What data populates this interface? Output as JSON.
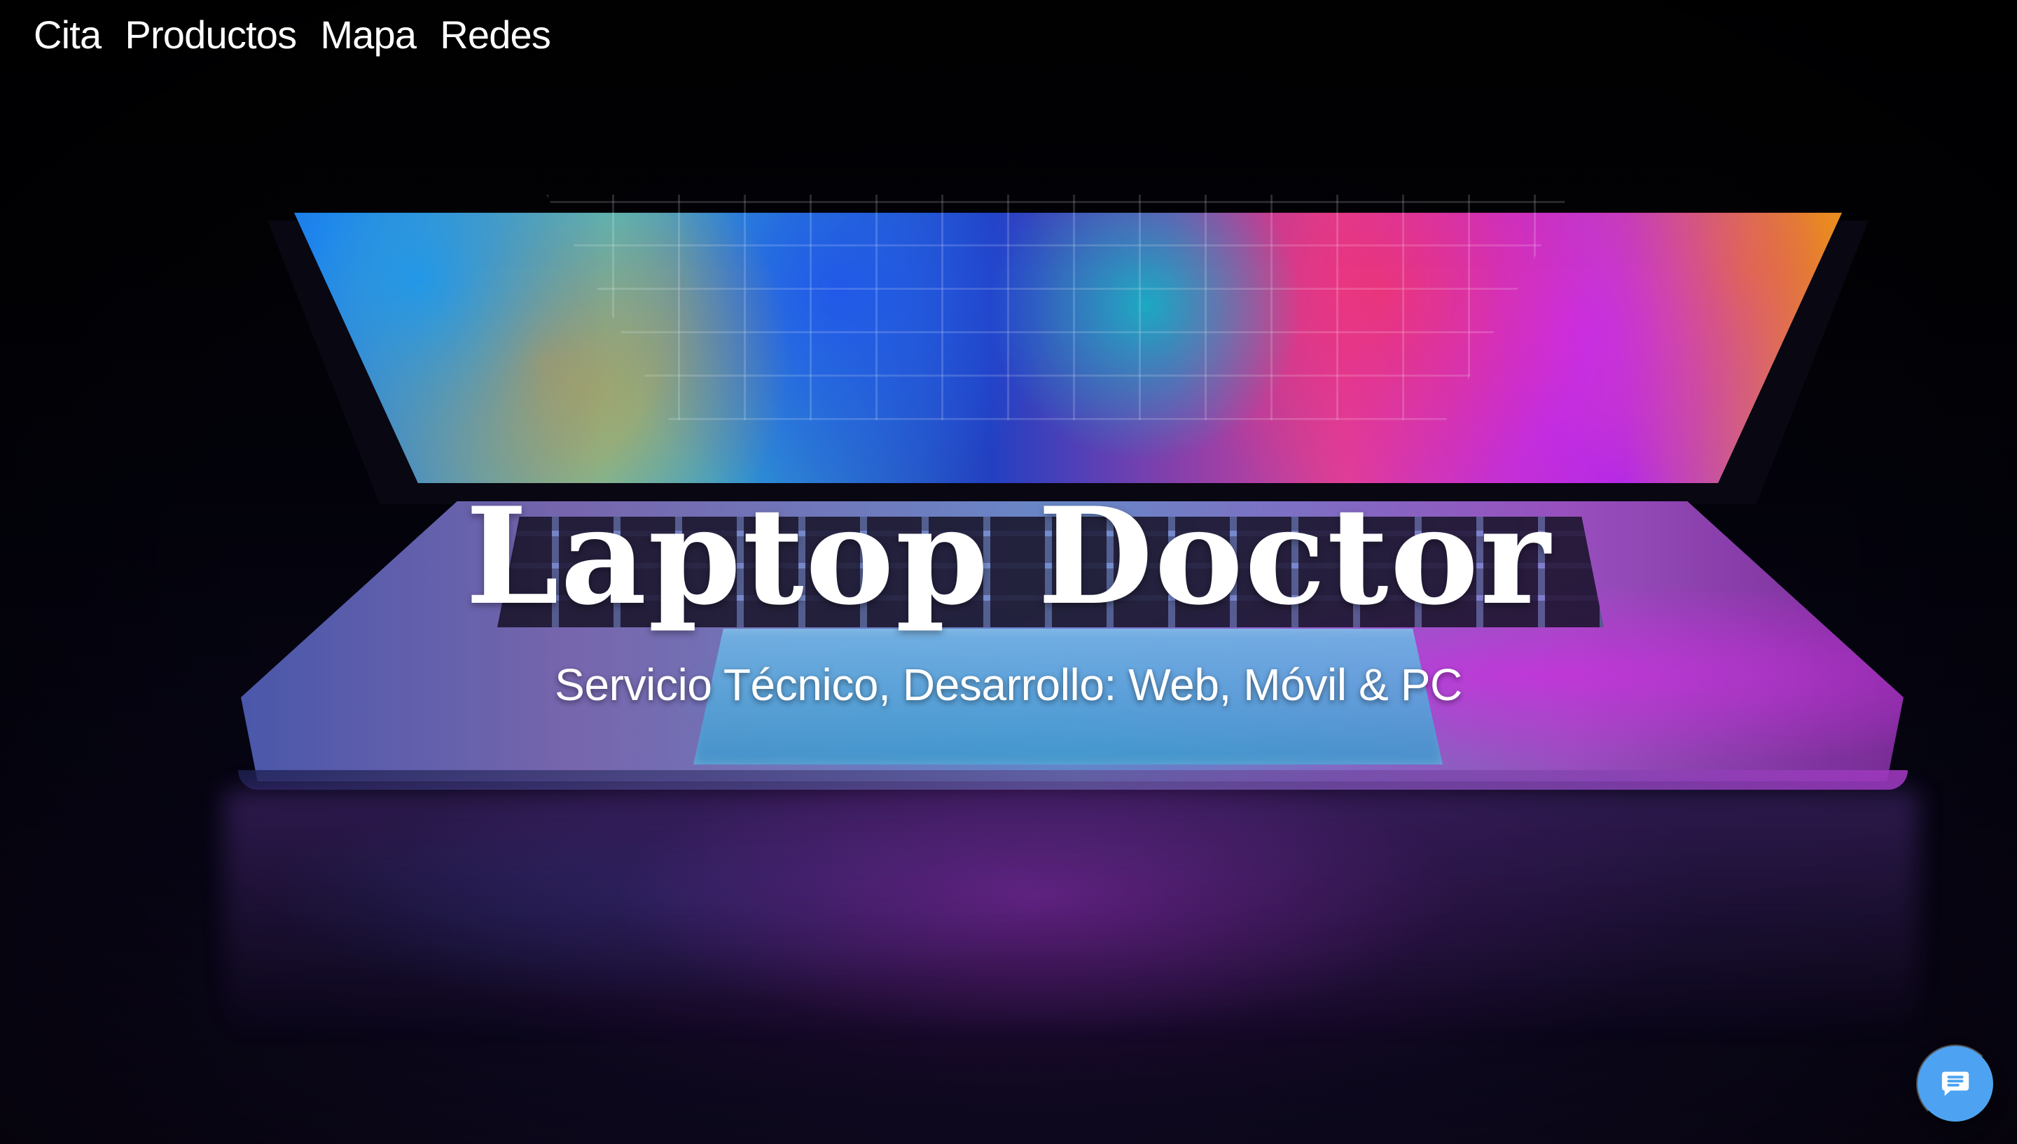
{
  "nav": {
    "items": [
      {
        "label": "Cita"
      },
      {
        "label": "Productos"
      },
      {
        "label": "Mapa"
      },
      {
        "label": "Redes"
      }
    ]
  },
  "hero": {
    "title": "Laptop Doctor",
    "subtitle": "Servicio Técnico, Desarrollo: Web, Móvil & PC",
    "background_image": "laptop-neon-hero-image"
  },
  "chat": {
    "icon": "chat-bubble-icon",
    "color": "#4da3f1"
  },
  "colors": {
    "text": "#ffffff",
    "chat_button": "#4da3f1",
    "background": "#030207"
  }
}
